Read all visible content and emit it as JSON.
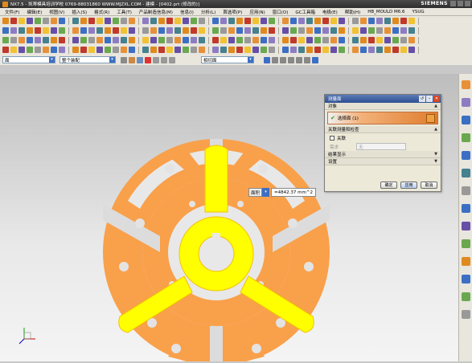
{
  "title": {
    "text": "NX7.5 - 凯蒂模具培训学校 0769-88031860 WWW.MJZXL.COM - 建模 - [0402.prt (修改的)]",
    "brand": "SIEMENS"
  },
  "menu": [
    "文件(F)",
    "编辑(E)",
    "视图(V)",
    "插入(S)",
    "格式(R)",
    "工具(T)",
    "产品制造信息(M)",
    "信息(I)",
    "分析(L)",
    "首选项(P)",
    "应用(N)",
    "窗口(O)",
    "GC工具箱",
    "电极(E)",
    "帮助(H)",
    "HB_MOULD M6.6",
    "YSUG"
  ],
  "selection_bar": {
    "filter_type": "面",
    "scope": "整个装配",
    "snap": "相切面"
  },
  "dialog": {
    "title": "测量面",
    "section_object": "对象",
    "select_face_label": "选择面 (1)",
    "section_assoc": "关联测量和检查",
    "assoc_label": "关联",
    "requirement_label": "需求",
    "requirement_value": "无",
    "section_result": "结果显示",
    "section_settings": "设置",
    "ok_label": "确定",
    "apply_label": "应用",
    "cancel_label": "取消"
  },
  "measurement": {
    "type_label": "面积",
    "value": "=4842.37 mm^2"
  },
  "colors": {
    "part": "#f9a04b",
    "selected_face": "#ffff00",
    "dialog_header": "#2d4f92"
  },
  "icons": [
    "file-new-icon",
    "open-icon",
    "save-icon",
    "undo-icon",
    "redo-icon",
    "extrude-icon",
    "revolve-icon",
    "hole-icon",
    "blend-icon",
    "chamfer-icon",
    "cube-icon",
    "sphere-icon",
    "measure-icon",
    "layer-icon",
    "wcs-icon"
  ]
}
